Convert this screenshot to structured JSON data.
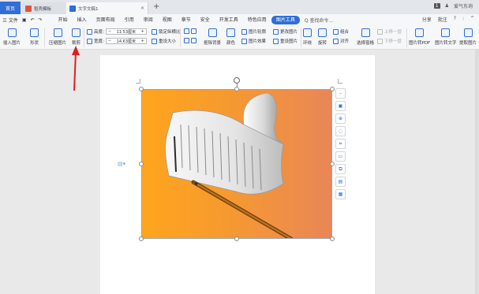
{
  "tabs": {
    "home": "首页",
    "items": [
      {
        "label": "稻壳模板",
        "color": "#e0533b"
      },
      {
        "label": "文字文稿1",
        "color": "#2f6fd6"
      }
    ],
    "add": "+"
  },
  "titlebar_right": {
    "count": "1",
    "user": "爱气东询"
  },
  "menu": {
    "file": "三 文件",
    "tabs": [
      "开始",
      "插入",
      "页面布局",
      "引用",
      "审阅",
      "视图",
      "章节",
      "安全",
      "开发工具",
      "特色应用",
      "图片工具"
    ],
    "active_tab": "图片工具",
    "search": "Q 查找命令...",
    "right": [
      "分享",
      "批注",
      "?",
      ":",
      "^"
    ]
  },
  "ribbon": {
    "insert_pic": "插入图片",
    "shape": "形状",
    "compress": "压缩图片",
    "crop": "裁剪",
    "height_label": "高度:",
    "height_value": "11.53厘米",
    "width_label": "宽度:",
    "width_value": "14.63厘米",
    "lock_ratio": "锁定纵横比",
    "reset_size": "重设大小",
    "cutout": "抠除背景",
    "color": "颜色",
    "outline": "图片轮廓",
    "effect": "图片效果",
    "change_pic": "更改图片",
    "reset_pic": "重设图片",
    "wrap": "环绕",
    "rotate": "旋转",
    "group": "组合",
    "align": "对齐",
    "select_pane": "选择窗格",
    "up_layer": "上移一层",
    "down_layer": "下移一层",
    "to_pdf": "图片转PDF",
    "to_text": "图片转文字",
    "extract": "提取图片"
  }
}
